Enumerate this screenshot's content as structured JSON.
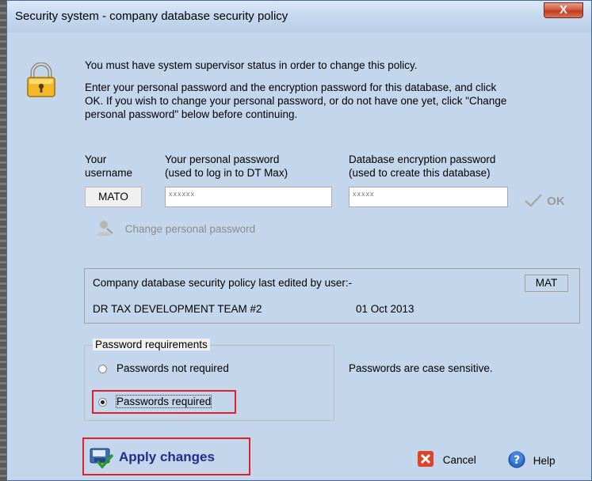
{
  "window": {
    "title": "Security system - company database security policy",
    "close_label": "X"
  },
  "intro": {
    "line1": "You must have system supervisor status in order to change this policy.",
    "para_lines": [
      "Enter your personal password and the encryption password for this database, and click",
      "OK. If you wish to change your personal password, or do not have one yet, click \"Change",
      "personal password\" below before continuing."
    ]
  },
  "credentials": {
    "username_label": [
      "Your",
      "username"
    ],
    "personal_label": [
      "Your personal password",
      "(used to log in to DT Max)"
    ],
    "encryption_label": [
      "Database encryption password",
      "(used to create this database)"
    ],
    "username_value": "MATO",
    "personal_mask": "xxxxxx",
    "encryption_mask": "xxxxx",
    "ok_label": "OK"
  },
  "change_password": {
    "label": "Change personal password"
  },
  "policy": {
    "edited_label": "Company database security policy last edited by user:-",
    "user_code": "MAT",
    "team": "DR TAX DEVELOPMENT TEAM #2",
    "date": "01 Oct 2013"
  },
  "requirements": {
    "legend": "Password requirements",
    "options": [
      {
        "label": "Passwords not required",
        "checked": false
      },
      {
        "label": "Passwords required",
        "checked": true
      }
    ],
    "note": "Passwords are case sensitive."
  },
  "footer": {
    "apply_label": "Apply changes",
    "cancel_label": "Cancel",
    "help_label": "Help"
  },
  "colors": {
    "highlight": "#e2202a",
    "apply_text": "#1f2e8c"
  }
}
